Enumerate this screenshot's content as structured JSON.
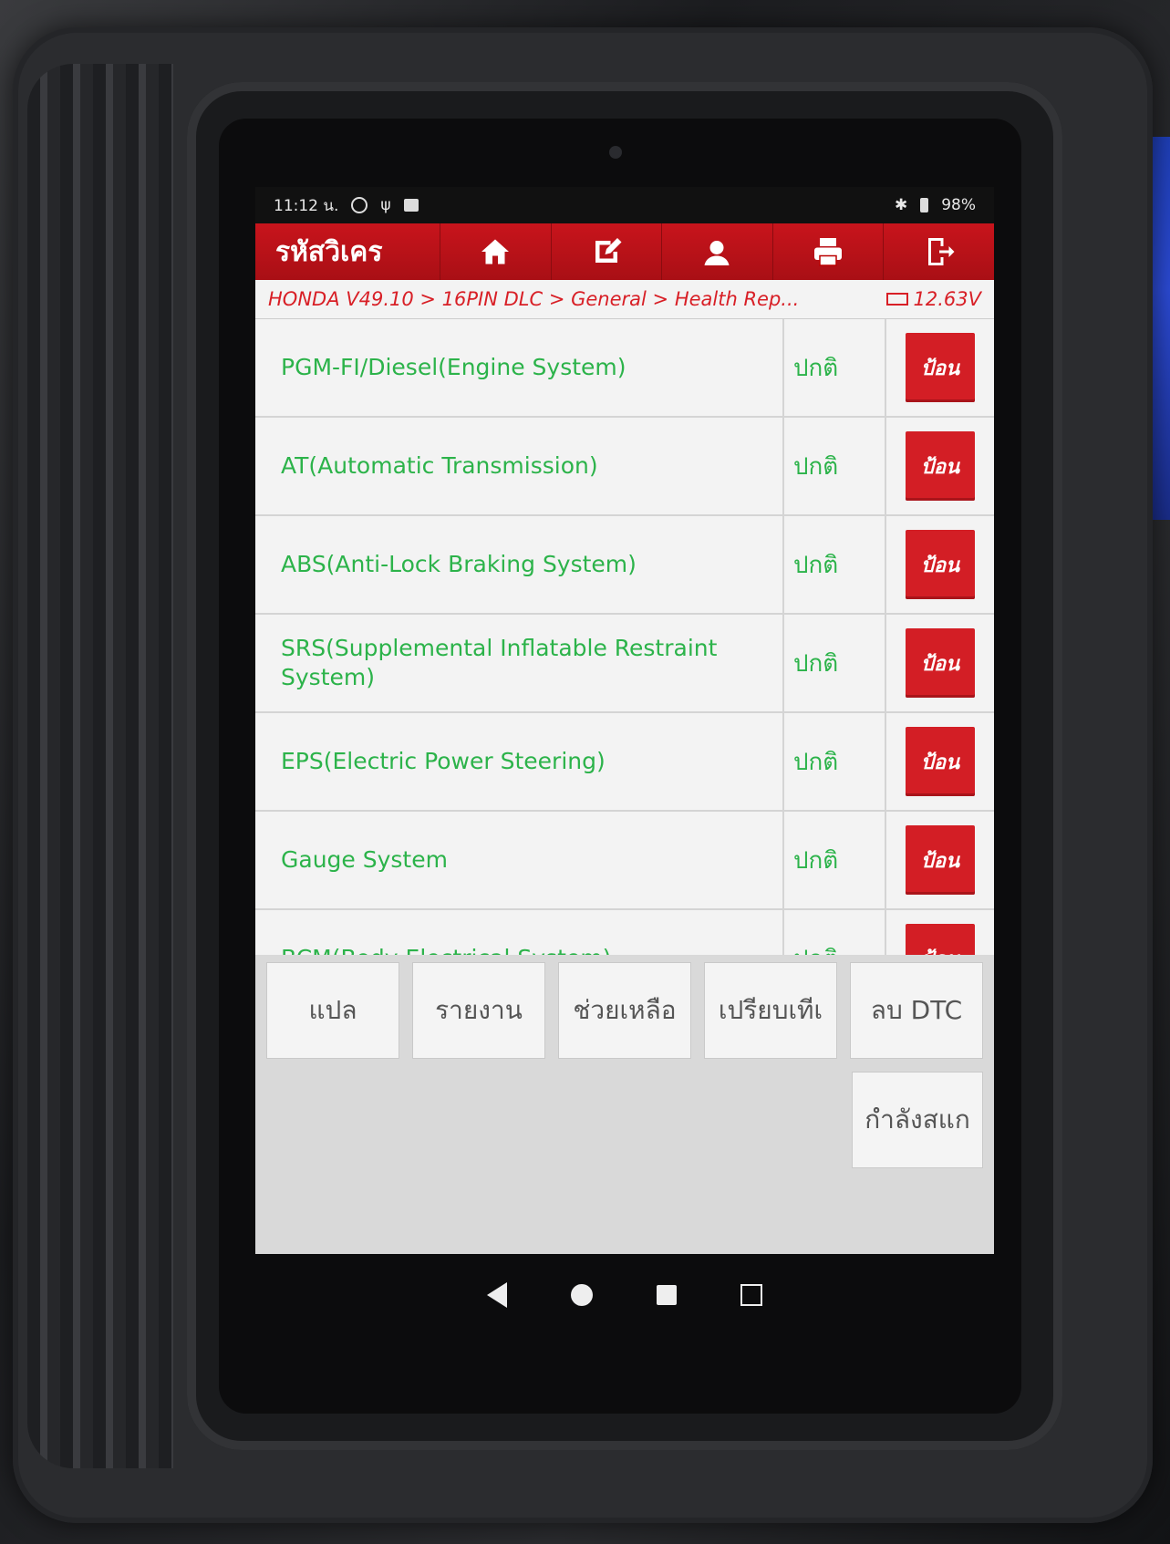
{
  "status_bar": {
    "time": "11:12 น.",
    "battery": "98%"
  },
  "header": {
    "title": "รหัสวิเคร",
    "buttons": [
      "home-icon",
      "edit-report-icon",
      "user-icon",
      "print-icon",
      "exit-icon"
    ]
  },
  "breadcrumb": {
    "path": "HONDA V49.10 > 16PIN DLC > General > Health Rep...",
    "voltage": "12.63V"
  },
  "systems": [
    {
      "name": "PGM-FI/Diesel(Engine System)",
      "status": "ปกติ",
      "action": "ป้อน"
    },
    {
      "name": "AT(Automatic Transmission)",
      "status": "ปกติ",
      "action": "ป้อน"
    },
    {
      "name": "ABS(Anti-Lock Braking System)",
      "status": "ปกติ",
      "action": "ป้อน"
    },
    {
      "name": "SRS(Supplemental Inflatable Restraint System)",
      "status": "ปกติ",
      "action": "ป้อน"
    },
    {
      "name": "EPS(Electric Power Steering)",
      "status": "ปกติ",
      "action": "ป้อน"
    },
    {
      "name": "Gauge System",
      "status": "ปกติ",
      "action": "ป้อน"
    },
    {
      "name": "BCM(Body Electrical System)",
      "status": "ปกติ",
      "action": "ป้อน"
    }
  ],
  "bottom_buttons": [
    "แปล",
    "รายงาน",
    "ช่วยเหลือ",
    "เปรียบเทีเ",
    "ลบ DTC"
  ],
  "extra_button": "กำลังสแก",
  "colors": {
    "header_red": "#c8141c",
    "status_green": "#2cb34a",
    "button_red": "#d31e25"
  }
}
